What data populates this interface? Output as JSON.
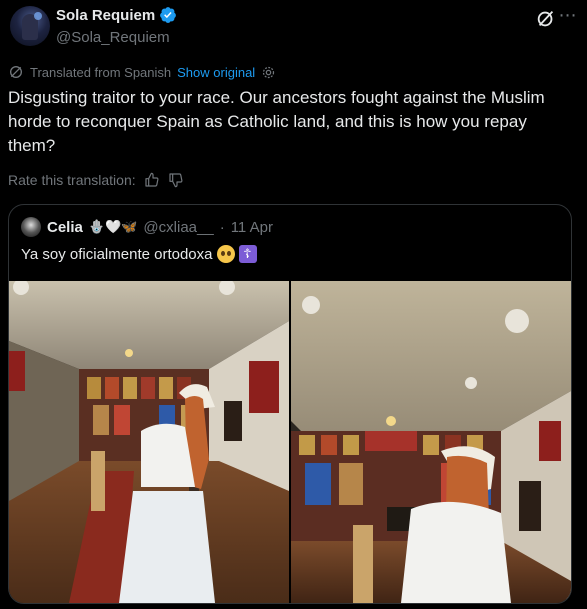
{
  "author": {
    "display_name": "Sola Requiem",
    "handle": "@Sola_Requiem",
    "verified": true
  },
  "translation": {
    "notice": "Translated from Spanish",
    "show_original": "Show original"
  },
  "tweet_text": "Disgusting traitor to your race. Our ancestors fought against the Muslim horde to reconquer Spain as Catholic land, and this is how you repay them?",
  "rate": {
    "label": "Rate this translation:"
  },
  "quoted": {
    "display_name": "Celia",
    "name_emoji": "🪬🤍🦋",
    "handle": "@cxliaa__",
    "separator": "·",
    "date": "11 Apr",
    "text": "Ya soy oficialmente ortodoxa",
    "emoji_cross": "☦"
  },
  "colors": {
    "background": "#000000",
    "text": "#e7e9ea",
    "muted": "#71767b",
    "link": "#1d9bf0",
    "border": "#2f3336",
    "verified": "#1d9bf0"
  },
  "icons": [
    "verified-badge-icon",
    "grok-icon",
    "more-icon",
    "translate-icon",
    "gear-icon",
    "thumbs-up-icon",
    "thumbs-down-icon"
  ]
}
